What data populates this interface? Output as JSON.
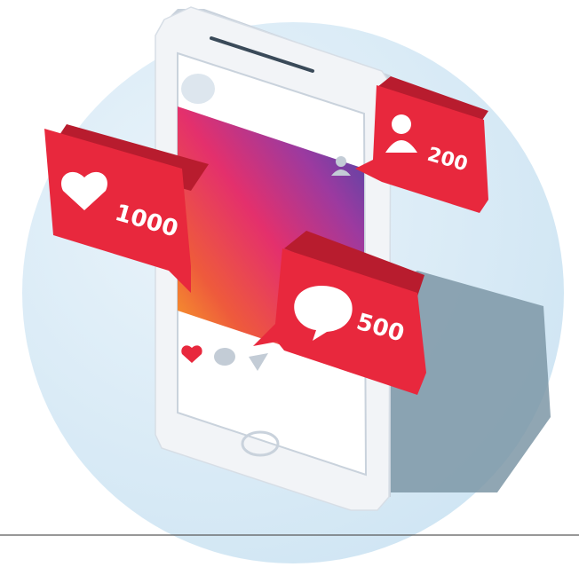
{
  "illustration": {
    "colors": {
      "background_circle": "#d6e9f5",
      "phone_body": "#f2f4f7",
      "phone_edge": "#c9d2dc",
      "phone_shadow": "#7d97a6",
      "badge_red": "#e8283d",
      "badge_shadow": "#b81c2e",
      "gradient": [
        "#f9b024",
        "#ee3a6a",
        "#b53692",
        "#5c3fa5",
        "#3d4aa8"
      ]
    },
    "badges": {
      "likes": {
        "icon": "heart-icon",
        "count": "1000"
      },
      "comments": {
        "icon": "speech-bubble-icon",
        "count": "500"
      },
      "followers": {
        "icon": "person-icon",
        "count": "200"
      }
    },
    "post_actions": {
      "like": "heart-icon",
      "comment": "speech-bubble-icon",
      "share": "send-icon"
    }
  }
}
